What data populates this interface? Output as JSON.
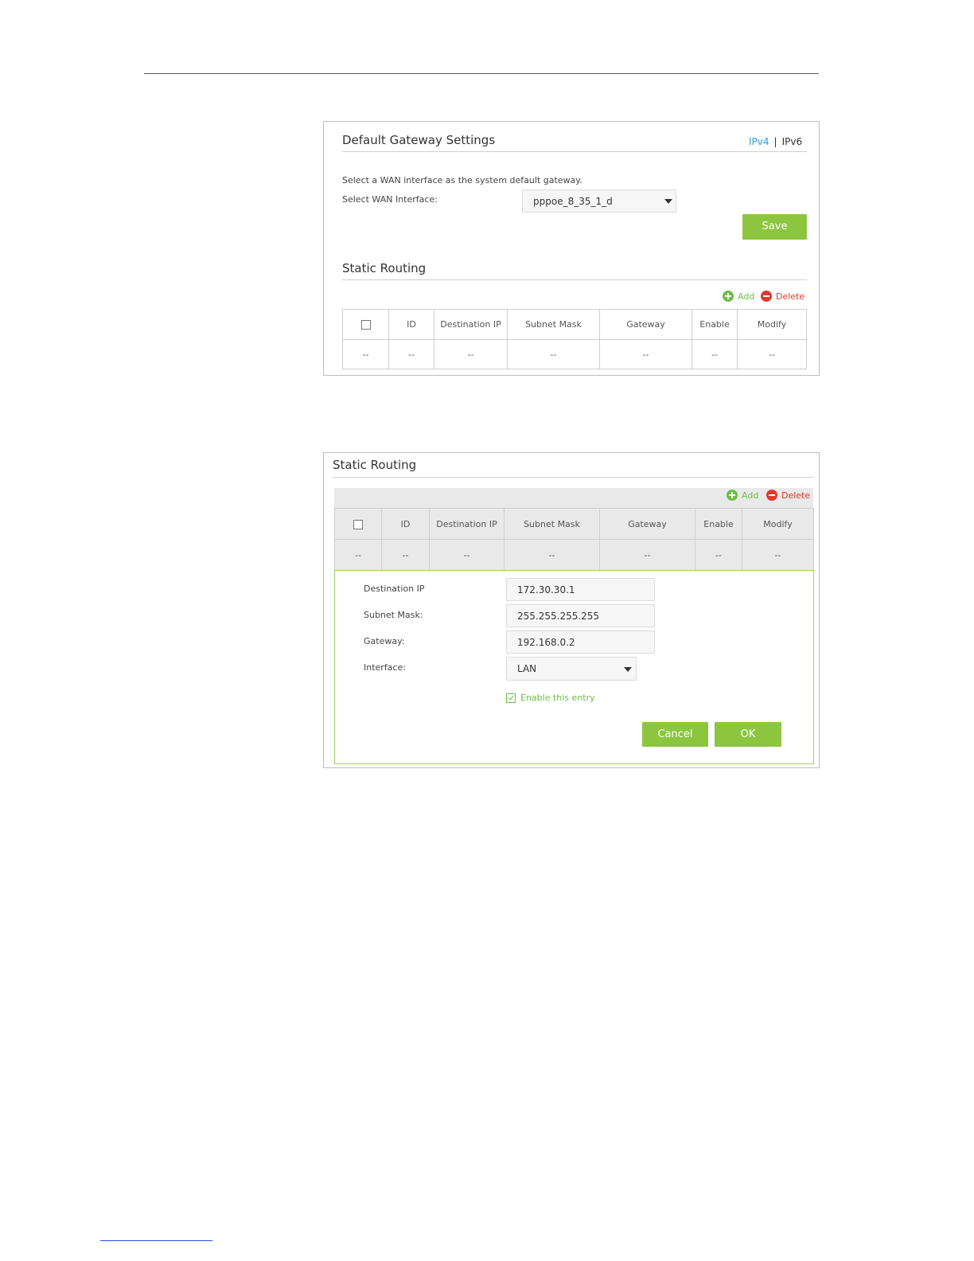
{
  "gateway_panel": {
    "title": "Default Gateway Settings",
    "ip_tabs": {
      "ipv4": "IPv4",
      "separator": "|",
      "ipv6": "IPv6",
      "active": "IPv4"
    },
    "description": "Select a WAN interface as the system default gateway.",
    "wan_label": "Select WAN Interface:",
    "wan_value": "pppoe_8_35_1_d",
    "save_label": "Save"
  },
  "routing_panel": {
    "title": "Static Routing",
    "add_label": "Add",
    "delete_label": "Delete",
    "columns": [
      "",
      "ID",
      "Destination IP",
      "Subnet Mask",
      "Gateway",
      "Enable",
      "Modify"
    ],
    "row": [
      "--",
      "--",
      "--",
      "--",
      "--",
      "--",
      "--"
    ]
  },
  "routing_edit_panel": {
    "title": "Static Routing",
    "add_label": "Add",
    "delete_label": "Delete",
    "columns": [
      "",
      "ID",
      "Destination IP",
      "Subnet Mask",
      "Gateway",
      "Enable",
      "Modify"
    ],
    "row": [
      "--",
      "--",
      "--",
      "--",
      "--",
      "--",
      "--"
    ],
    "form": {
      "dest_ip_label": "Destination IP",
      "dest_ip_value": "172.30.30.1",
      "subnet_label": "Subnet Mask:",
      "subnet_value": "255.255.255.255",
      "gateway_label": "Gateway:",
      "gateway_value": "192.168.0.2",
      "interface_label": "Interface:",
      "interface_value": "LAN",
      "enable_label": "Enable this entry",
      "enable_checked": true,
      "cancel_label": "Cancel",
      "ok_label": "OK"
    }
  },
  "colors": {
    "accent_green": "#8cc63f",
    "add_green": "#6cbe45",
    "delete_red": "#e0392e",
    "link_blue": "#2a9fd6"
  }
}
